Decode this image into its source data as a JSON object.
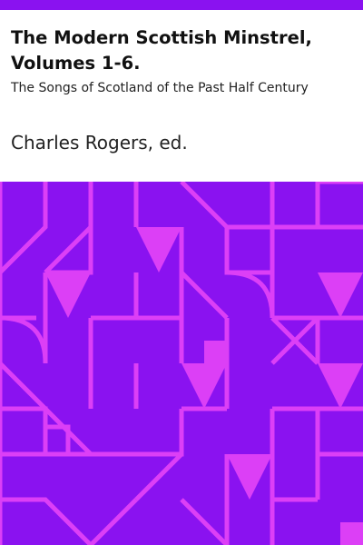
{
  "colors": {
    "background": "#8a12f0",
    "pattern": "#dc3ff6",
    "header_bg": "#ffffff",
    "text": "#111111"
  },
  "book": {
    "title": "The Modern Scottish Minstrel, Volumes 1-6.",
    "subtitle": "The Songs of Scotland of the Past Half Century",
    "author": "Charles Rogers, ed."
  }
}
